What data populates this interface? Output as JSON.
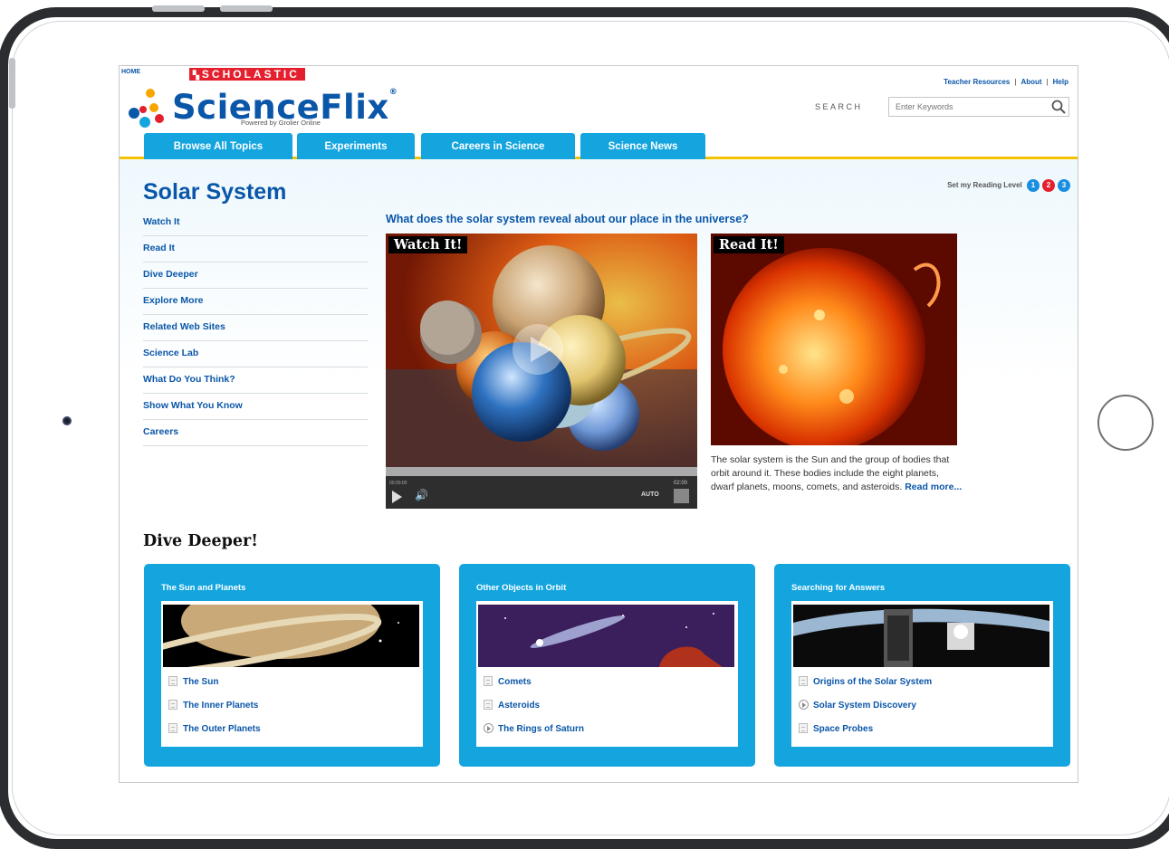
{
  "header": {
    "home_link": "HOME",
    "scholastic": "SCHOLASTIC",
    "logo_text_science": "Science",
    "logo_text_flix": "Flix",
    "trademark": "®",
    "powered_by": "Powered by Grolier Online",
    "top_links": [
      "Teacher Resources",
      "About",
      "Help"
    ],
    "search_label": "SEARCH",
    "search_placeholder": "Enter Keywords"
  },
  "tabs": [
    "Browse All Topics",
    "Experiments",
    "Careers in Science",
    "Science News"
  ],
  "page": {
    "title": "Solar System",
    "reading_level_label": "Set my Reading Level",
    "reading_levels": [
      "1",
      "2",
      "3"
    ],
    "question": "What does the solar system reveal about our place in the universe?"
  },
  "sidebar": {
    "items": [
      "Watch It",
      "Read It",
      "Dive Deeper",
      "Explore More",
      "Related Web Sites",
      "Science Lab",
      "What Do You Think?",
      "Show What You Know",
      "Careers"
    ]
  },
  "video": {
    "badge": "Watch It!",
    "timecode": "00:00:00",
    "duration": "02:00",
    "auto_label": "AUTO"
  },
  "read": {
    "badge": "Read It!",
    "text": "The solar system is the Sun and the group of bodies that orbit around it. These bodies include the eight planets, dwarf planets, moons, comets, and asteroids.",
    "read_more": "Read more..."
  },
  "dive": {
    "title": "Dive Deeper!",
    "cards": [
      {
        "title": "The Sun and Planets",
        "links": [
          {
            "label": "The Sun",
            "icon": "document-icon"
          },
          {
            "label": "The Inner Planets",
            "icon": "document-icon"
          },
          {
            "label": "The Outer Planets",
            "icon": "document-icon"
          }
        ]
      },
      {
        "title": "Other Objects in Orbit",
        "links": [
          {
            "label": "Comets",
            "icon": "document-icon"
          },
          {
            "label": "Asteroids",
            "icon": "document-icon"
          },
          {
            "label": "The Rings of Saturn",
            "icon": "video-play-icon"
          }
        ]
      },
      {
        "title": "Searching for Answers",
        "links": [
          {
            "label": "Origins of the Solar System",
            "icon": "document-icon"
          },
          {
            "label": "Solar System Discovery",
            "icon": "video-play-icon"
          },
          {
            "label": "Space Probes",
            "icon": "document-icon"
          }
        ]
      }
    ]
  },
  "colors": {
    "accent_blue": "#14a5df",
    "link_blue": "#0a56a8",
    "header_rule": "#f2c200",
    "scholastic_red": "#e5202e",
    "level_1": "#1a8fe0",
    "level_2": "#e5202e",
    "level_3": "#1a8fe0"
  }
}
